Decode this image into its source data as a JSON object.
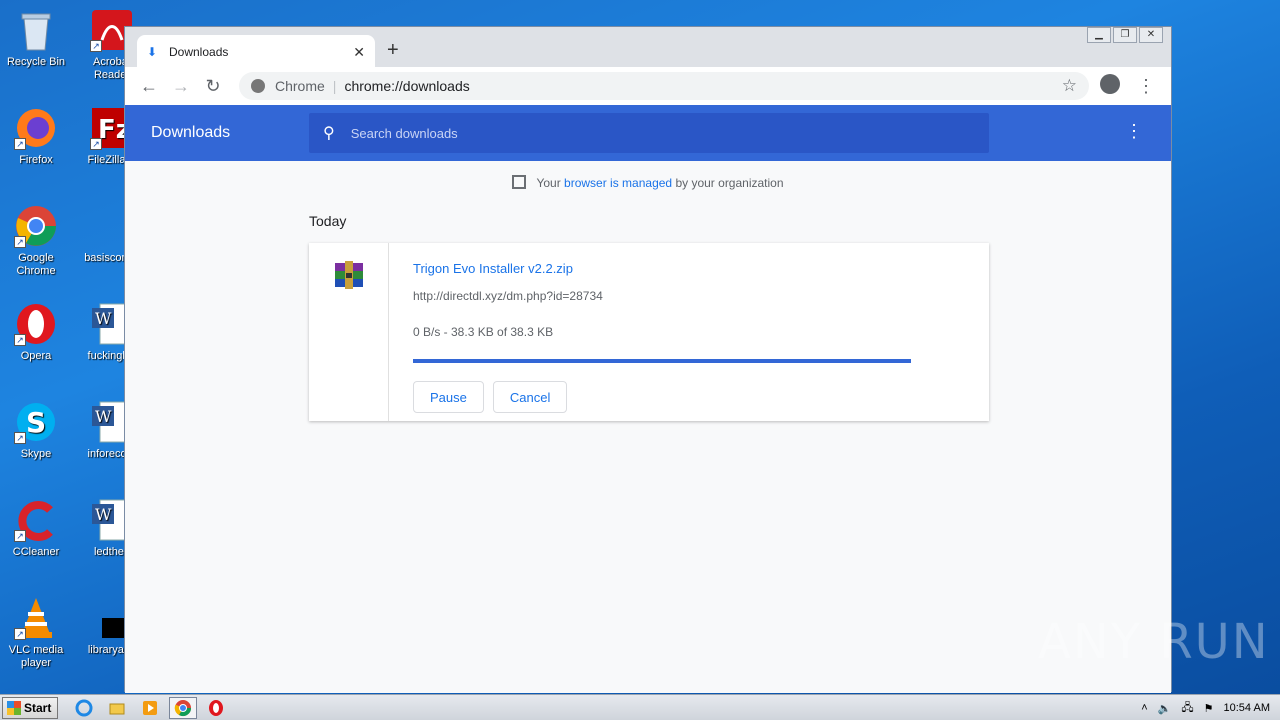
{
  "desktop": {
    "icons": [
      {
        "label": "Recycle Bin",
        "icon": "recycle-bin-icon"
      },
      {
        "label": "Acrobat Reader",
        "icon": "acrobat-icon"
      },
      {
        "label": "Firefox",
        "icon": "firefox-icon"
      },
      {
        "label": "FileZilla C",
        "icon": "filezilla-icon"
      },
      {
        "label": "Google Chrome",
        "icon": "chrome-icon"
      },
      {
        "label": "basiscomm",
        "icon": "document-icon"
      },
      {
        "label": "Opera",
        "icon": "opera-icon"
      },
      {
        "label": "fuckingloc",
        "icon": "word-doc-icon"
      },
      {
        "label": "Skype",
        "icon": "skype-icon"
      },
      {
        "label": "inforecord",
        "icon": "word-doc-icon"
      },
      {
        "label": "CCleaner",
        "icon": "ccleaner-icon"
      },
      {
        "label": "ledthen",
        "icon": "word-doc-icon"
      },
      {
        "label": "VLC media player",
        "icon": "vlc-icon"
      },
      {
        "label": "libraryapp",
        "icon": "app-icon"
      }
    ]
  },
  "browser": {
    "tab": {
      "title": "Downloads",
      "icon": "download-icon"
    },
    "omnibox": {
      "site": "Chrome",
      "url": "chrome://downloads"
    },
    "header": {
      "title": "Downloads",
      "search_placeholder": "Search downloads"
    },
    "managed": {
      "prefix": "Your",
      "link": "browser is managed",
      "suffix": "by your organization"
    },
    "section": "Today",
    "download": {
      "filename": "Trigon Evo Installer v2.2.zip",
      "url": "http://directdl.xyz/dm.php?id=28734",
      "status": "0 B/s - 38.3 KB of 38.3 KB",
      "progress": 1.0,
      "pause_label": "Pause",
      "cancel_label": "Cancel"
    },
    "colors": {
      "accent": "#3367d6",
      "link": "#1a73e8"
    }
  },
  "taskbar": {
    "start_label": "Start",
    "clock": "10:54 AM",
    "apps": [
      "ie-icon",
      "explorer-icon",
      "media-player-icon",
      "chrome-icon",
      "opera-icon"
    ]
  },
  "watermark": "ANY RUN"
}
